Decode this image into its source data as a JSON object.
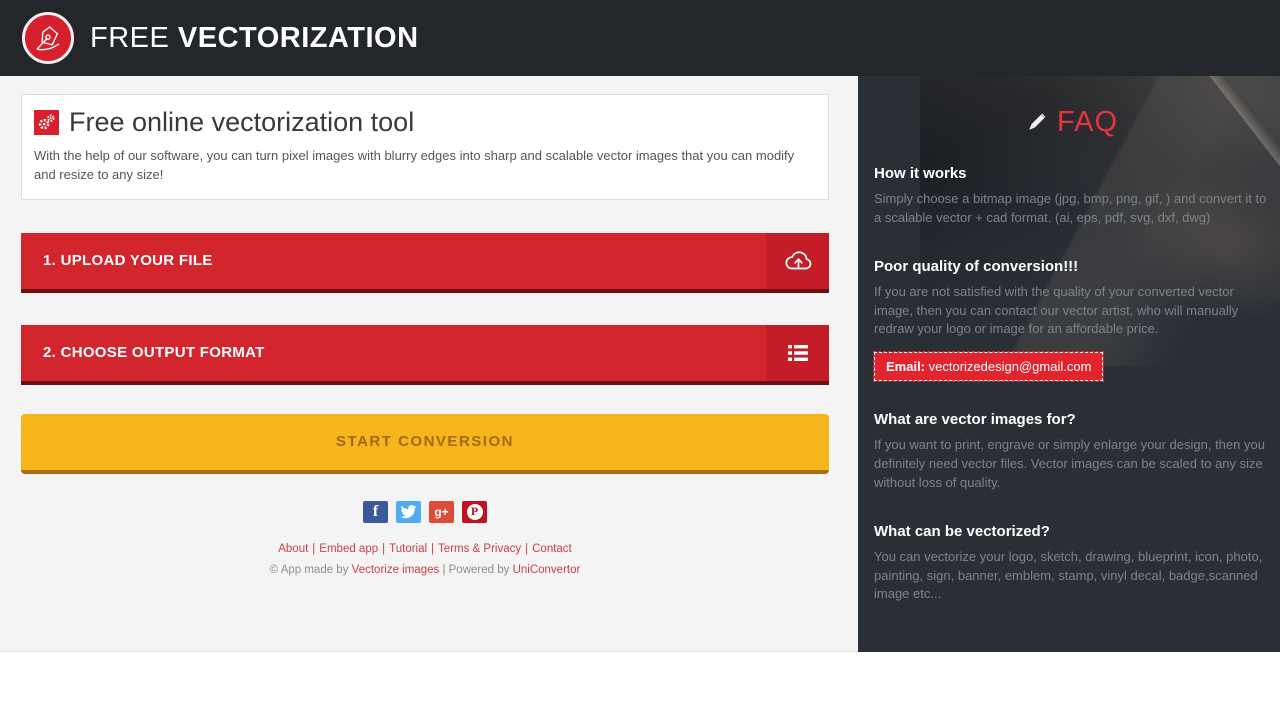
{
  "header": {
    "title_light": "FREE",
    "title_bold": "VECTORIZATION"
  },
  "intro": {
    "title": "Free online vectorization tool",
    "description": "With the help of our software, you can turn pixel images with blurry edges into sharp and scalable vector images that you can modify and resize to any size!"
  },
  "buttons": {
    "upload_label": "1. UPLOAD YOUR FILE",
    "format_label": "2. CHOOSE OUTPUT FORMAT",
    "start_label": "START CONVERSION"
  },
  "social": {
    "facebook": "f",
    "google_plus": "g+",
    "pinterest": "P"
  },
  "footer": {
    "separator": "|",
    "links": [
      "About",
      "Embed app",
      "Tutorial",
      "Terms & Privacy",
      "Contact"
    ],
    "credit_prefix": "© App made by",
    "credit_link1": "Vectorize images",
    "credit_mid": "| Powered by",
    "credit_link2": "UniConvertor"
  },
  "faq": {
    "title": "FAQ",
    "sections": [
      {
        "heading": "How it works",
        "body": "Simply choose a bitmap image (jpg, bmp, png, gif, ) and convert it to a scalable vector + cad format. (ai, eps, pdf, svg, dxf, dwg)"
      },
      {
        "heading": "Poor quality of conversion!!!",
        "body": "If you are not satisfied with the quality of your converted vector image, then you can contact our vector artist, who will manually redraw your logo or image for an affordable price.",
        "email_label": "Email:",
        "email_value": "vectorizedesign@gmail.com"
      },
      {
        "heading": "What are vector images for?",
        "body": "If you want to print, engrave or simply enlarge your design, then you definitely need vector files. Vector images can be scaled to any size without loss of quality."
      },
      {
        "heading": "What can be vectorized?",
        "body": "You can vectorize your logo, sketch, drawing, blueprint, icon, photo, painting, sign, banner, emblem, stamp, vinyl decal, badge,scanned image etc..."
      }
    ]
  },
  "colors": {
    "header_bg": "#23272b",
    "accent_red": "#d2252e",
    "accent_yellow": "#f6b51d",
    "sidebar_bg": "#2a2f36",
    "faq_red": "#e8323e",
    "link_red": "#c8414b"
  }
}
